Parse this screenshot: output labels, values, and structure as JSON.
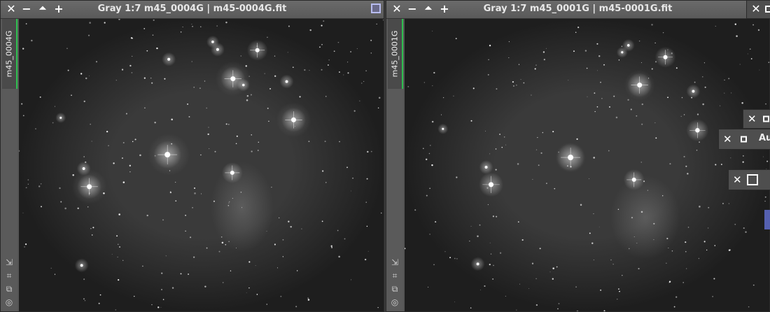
{
  "windows": [
    {
      "title": "Gray 1:7 m45_0004G | m45-0004G.fit",
      "tab": "m45_0004G"
    },
    {
      "title": "Gray 1:7 m45_0001G | m45-0001G.fit",
      "tab": "m45_0001G"
    }
  ],
  "panels": {
    "partial_label": "Au"
  },
  "colors": {
    "tab_accent": "#2fbf4f",
    "sky": "#303030",
    "chrome": "#555555"
  },
  "icons": [
    "close-icon",
    "minimize-icon",
    "shade-icon",
    "maximize-icon",
    "fit-window-icon",
    "fit-view-icon",
    "clone-icon",
    "target-icon"
  ]
}
